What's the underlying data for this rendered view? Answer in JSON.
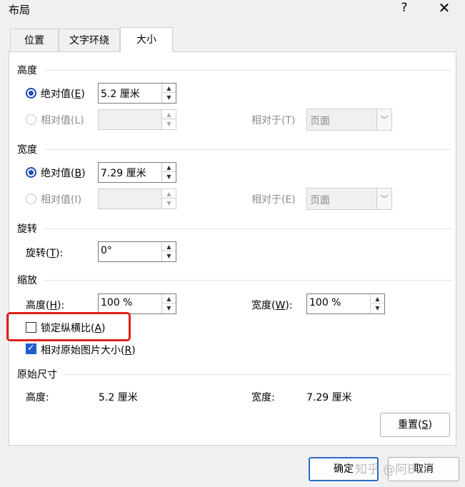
{
  "window": {
    "title": "布局",
    "help_label": "?",
    "close_label": "✕"
  },
  "tabs": [
    {
      "label": "位置"
    },
    {
      "label": "文字环绕"
    },
    {
      "label": "大小"
    }
  ],
  "height": {
    "section_label": "高度",
    "absolute_label": "绝对值(",
    "absolute_key": "E",
    "absolute_value": "5.2 厘米",
    "relative_label": "相对值(L)",
    "relative_to_label": "相对于(T)",
    "relative_to_value": "页面"
  },
  "width": {
    "section_label": "宽度",
    "absolute_label": "绝对值(",
    "absolute_key": "B",
    "absolute_value": "7.29 厘米",
    "relative_label": "相对值(I)",
    "relative_to_label": "相对于(E)",
    "relative_to_value": "页面"
  },
  "rotation": {
    "section_label": "旋转",
    "label": "旋转(",
    "key": "T",
    "value": "0°"
  },
  "scale": {
    "section_label": "缩放",
    "height_label": "高度(",
    "height_key": "H",
    "height_value": "100 %",
    "width_label": "宽度(",
    "width_key": "W",
    "width_value": "100 %",
    "lock_label": "锁定纵横比(",
    "lock_key": "A",
    "lock_checked": false,
    "relative_label": "相对原始图片大小(",
    "relative_key": "R",
    "relative_checked": true
  },
  "original": {
    "section_label": "原始尺寸",
    "height_label": "高度:",
    "height_value": "5.2 厘米",
    "width_label": "宽度:",
    "width_value": "7.29 厘米",
    "reset_label": "重置(",
    "reset_key": "S"
  },
  "footer": {
    "ok_label": "确定",
    "cancel_label": "取消"
  },
  "watermark": "知乎 @阿Bai",
  "colors": {
    "accent": "#1f5fcc",
    "highlight": "#e0201c"
  }
}
